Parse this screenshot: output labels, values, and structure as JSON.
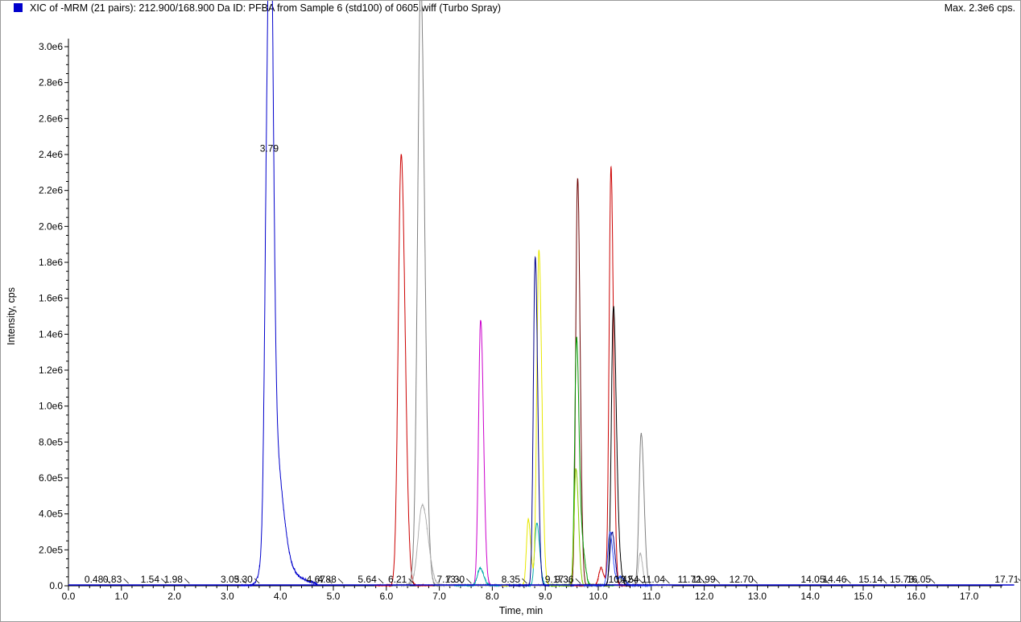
{
  "header": {
    "title": "XIC of -MRM (21 pairs): 212.900/168.900 Da ID: PFBA from Sample 6 (std100) of 0605.wiff (Turbo Spray)",
    "max_label": "Max. 2.3e6 cps.",
    "legend_color": "#0000cc"
  },
  "chart_data": {
    "type": "line",
    "title": "XIC of -MRM (21 pairs): 212.900/168.900 Da ID: PFBA from Sample 6 (std100) of 0605.wiff (Turbo Spray)",
    "xlabel": "Time, min",
    "ylabel": "Intensity, cps",
    "xlim": [
      0,
      18.0
    ],
    "ylim": [
      0,
      3000000.0
    ],
    "x_ticks": [
      "0.0",
      "1.0",
      "2.0",
      "3.0",
      "4.0",
      "5.0",
      "6.0",
      "7.0",
      "8.0",
      "9.0",
      "10.0",
      "11.0",
      "12.0",
      "13.0",
      "14.0",
      "15.0",
      "16.0",
      "17.0"
    ],
    "y_ticks": [
      "0.0",
      "2.0e5",
      "4.0e5",
      "6.0e5",
      "8.0e5",
      "1.0e6",
      "1.2e6",
      "1.4e6",
      "1.6e6",
      "1.8e6",
      "2.0e6",
      "2.2e6",
      "2.4e6",
      "2.6e6",
      "2.8e6",
      "3.0e6"
    ],
    "peak_annotation": {
      "label": "3.79",
      "x": 3.79,
      "y": 2300000.0
    },
    "baseline_labels": [
      {
        "label": "0.48",
        "x": 0.48
      },
      {
        "label": "0.83",
        "x": 0.83
      },
      {
        "label": "1.54",
        "x": 1.54
      },
      {
        "label": "1.98",
        "x": 1.98
      },
      {
        "label": "3.05",
        "x": 3.05
      },
      {
        "label": "3.30",
        "x": 3.3
      },
      {
        "label": "4.67",
        "x": 4.67
      },
      {
        "label": "4.88",
        "x": 4.88
      },
      {
        "label": "5.64",
        "x": 5.64
      },
      {
        "label": "6.21",
        "x": 6.21
      },
      {
        "label": "7.13",
        "x": 7.13
      },
      {
        "label": "7.30",
        "x": 7.3
      },
      {
        "label": "8.35",
        "x": 8.35
      },
      {
        "label": "9.17",
        "x": 9.17
      },
      {
        "label": "9.36",
        "x": 9.36
      },
      {
        "label": "10.42",
        "x": 10.42
      },
      {
        "label": "10.54",
        "x": 10.54
      },
      {
        "label": "11.04",
        "x": 11.04
      },
      {
        "label": "11.72",
        "x": 11.72
      },
      {
        "label": "11.99",
        "x": 11.99
      },
      {
        "label": "12.70",
        "x": 12.7
      },
      {
        "label": "14.05",
        "x": 14.05
      },
      {
        "label": "14.46",
        "x": 14.46
      },
      {
        "label": "15.14",
        "x": 15.14
      },
      {
        "label": "15.73",
        "x": 15.73
      },
      {
        "label": "16.05",
        "x": 16.05
      },
      {
        "label": "17.71",
        "x": 17.71
      }
    ],
    "series": [
      {
        "color": "#0000cc",
        "peaks": [
          {
            "x": 3.75,
            "h": 1880000.0,
            "w": 0.045
          },
          {
            "x": 3.82,
            "h": 2280000.0,
            "w": 0.04
          },
          {
            "x": 3.86,
            "h": 800000.0,
            "w": 0.12
          },
          {
            "x": 4.1,
            "h": 60000.0,
            "w": 0.25
          }
        ]
      },
      {
        "color": "#cc0000",
        "peaks": [
          {
            "x": 6.28,
            "h": 2400000.0,
            "w": 0.055
          }
        ]
      },
      {
        "color": "#808080",
        "peaks": [
          {
            "x": 6.65,
            "h": 2990000.0,
            "w": 0.055
          },
          {
            "x": 6.62,
            "h": 400000.0,
            "w": 0.07
          },
          {
            "x": 10.81,
            "h": 850000.0,
            "w": 0.04
          }
        ]
      },
      {
        "color": "#b0b0b0",
        "peaks": [
          {
            "x": 6.68,
            "h": 450000.0,
            "w": 0.08
          },
          {
            "x": 10.79,
            "h": 180000.0,
            "w": 0.035
          }
        ]
      },
      {
        "color": "#cc00cc",
        "peaks": [
          {
            "x": 7.78,
            "h": 1480000.0,
            "w": 0.04
          }
        ]
      },
      {
        "color": "#00aaaa",
        "peaks": [
          {
            "x": 7.77,
            "h": 100000.0,
            "w": 0.05
          },
          {
            "x": 8.84,
            "h": 350000.0,
            "w": 0.04
          }
        ]
      },
      {
        "color": "#e8e800",
        "peaks": [
          {
            "x": 8.68,
            "h": 370000.0,
            "w": 0.035
          },
          {
            "x": 8.88,
            "h": 1870000.0,
            "w": 0.04
          }
        ]
      },
      {
        "color": "#00008b",
        "peaks": [
          {
            "x": 8.81,
            "h": 1830000.0,
            "w": 0.035
          },
          {
            "x": 10.26,
            "h": 300000.0,
            "w": 0.04
          }
        ]
      },
      {
        "color": "#6b0000",
        "peaks": [
          {
            "x": 9.61,
            "h": 2270000.0,
            "w": 0.035
          }
        ]
      },
      {
        "color": "#009900",
        "peaks": [
          {
            "x": 9.59,
            "h": 1380000.0,
            "w": 0.035
          },
          {
            "x": 9.7,
            "h": 200000.0,
            "w": 0.04
          }
        ]
      },
      {
        "color": "#88cc00",
        "peaks": [
          {
            "x": 9.58,
            "h": 650000.0,
            "w": 0.035
          }
        ]
      },
      {
        "color": "#cc0000",
        "peaks": [
          {
            "x": 10.24,
            "h": 2330000.0,
            "w": 0.035
          },
          {
            "x": 10.05,
            "h": 100000.0,
            "w": 0.04
          }
        ]
      },
      {
        "color": "#000000",
        "peaks": [
          {
            "x": 10.28,
            "h": 1070000.0,
            "w": 0.035
          },
          {
            "x": 10.31,
            "h": 550000.0,
            "w": 0.05
          }
        ]
      },
      {
        "color": "#3355ff",
        "peaks": [
          {
            "x": 10.22,
            "h": 300000.0,
            "w": 0.04
          },
          {
            "x": 10.42,
            "h": 50000.0,
            "w": 0.06
          }
        ]
      }
    ]
  }
}
